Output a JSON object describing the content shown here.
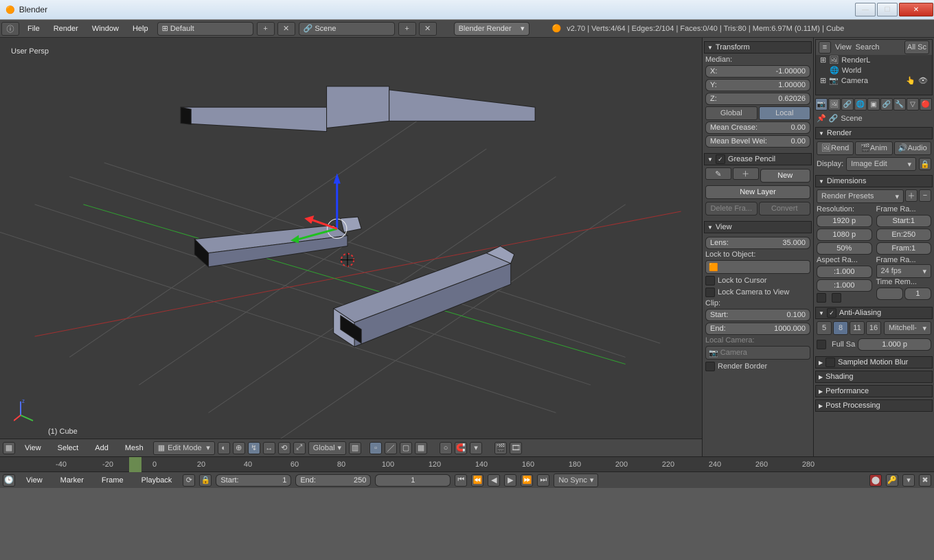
{
  "window": {
    "title": "Blender"
  },
  "win_ctrl": {
    "min": "—",
    "max": "☐",
    "close": "✕"
  },
  "topbar": {
    "menus": [
      "File",
      "Render",
      "Window",
      "Help"
    ],
    "layout": "Default",
    "scene": "Scene",
    "engine": "Blender Render",
    "stats": "v2.70 | Verts:4/64 | Edges:2/104 | Faces:0/40 | Tris:80 | Mem:6.97M (0.11M) | Cube"
  },
  "viewport": {
    "persp": "User Persp",
    "object": "(1) Cube"
  },
  "npanel": {
    "transform": {
      "title": "Transform",
      "median_label": "Median:",
      "x_label": "X:",
      "x": "-1.00000",
      "y_label": "Y:",
      "y": "1.00000",
      "z_label": "Z:",
      "z": "0.62026",
      "global": "Global",
      "local": "Local",
      "crease_label": "Mean Crease:",
      "crease": "0.00",
      "bevel_label": "Mean Bevel Wei:",
      "bevel": "0.00"
    },
    "grease": {
      "title": "Grease Pencil",
      "new": "New",
      "new_layer": "New Layer",
      "delete": "Delete Fra...",
      "convert": "Convert"
    },
    "view": {
      "title": "View",
      "lens_label": "Lens:",
      "lens": "35.000",
      "lock_obj": "Lock to Object:",
      "lock_cursor": "Lock to Cursor",
      "lock_camera": "Lock Camera to View",
      "clip": "Clip:",
      "start_label": "Start:",
      "start": "0.100",
      "end_label": "End:",
      "end": "1000.000",
      "local_cam": "Local Camera:",
      "camera": "Camera",
      "render_border": "Render Border"
    }
  },
  "outliner": {
    "menus": [
      "View",
      "Search"
    ],
    "filter": "All Sc",
    "items": [
      "RenderL",
      "World",
      "Camera"
    ]
  },
  "props": {
    "scene_name": "Scene",
    "render": {
      "title": "Render",
      "btns": [
        "Rend",
        "Anim",
        "Audio"
      ],
      "display_label": "Display:",
      "display": "Image Edit"
    },
    "dim": {
      "title": "Dimensions",
      "presets": "Render Presets",
      "res_label": "Resolution:",
      "resx": "1920 p",
      "resy": "1080 p",
      "respct": "50%",
      "fr_label": "Frame Ra...",
      "start": "Start:1",
      "end": "En:250",
      "step": "Fram:1",
      "aspect_label": "Aspect Ra...",
      "ax": ":1.000",
      "ay": ":1.000",
      "fps_label": "Frame Ra...",
      "fps": "24 fps",
      "tr_label": "Time Rem...",
      "tr_new": "1"
    },
    "aa": {
      "title": "Anti-Aliasing",
      "samples": [
        "5",
        "8",
        "11",
        "16"
      ],
      "filter": "Mitchell-",
      "full": "Full Sa",
      "size": "1.000 p"
    },
    "collapsed": [
      "Sampled Motion Blur",
      "Shading",
      "Performance",
      "Post Processing"
    ]
  },
  "view_header": {
    "menus": [
      "View",
      "Select",
      "Add",
      "Mesh"
    ],
    "mode": "Edit Mode",
    "orientation": "Global"
  },
  "timeline": {
    "ticks": [
      "-40",
      "-20",
      "0",
      "20",
      "40",
      "60",
      "80",
      "100",
      "120",
      "140",
      "160",
      "180",
      "200",
      "220",
      "240",
      "260",
      "280"
    ]
  },
  "tl_header": {
    "menus": [
      "View",
      "Marker",
      "Frame",
      "Playback"
    ],
    "start_label": "Start:",
    "start_val": "1",
    "end_label": "End:",
    "end_val": "250",
    "current": "1",
    "sync": "No Sync"
  }
}
